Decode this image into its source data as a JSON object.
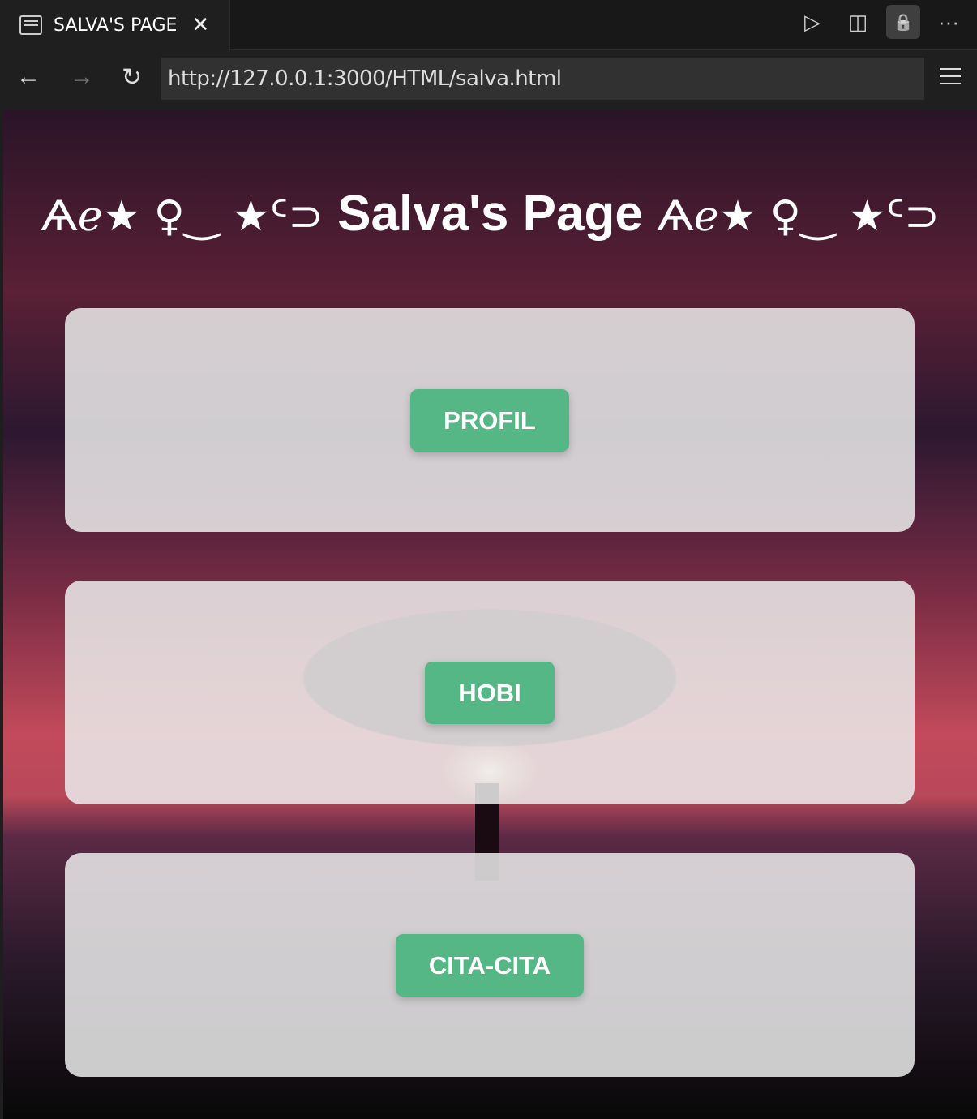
{
  "tab": {
    "title": "SALVA'S PAGE",
    "icon": "preview-icon",
    "close": "✕"
  },
  "toolbar": {
    "run": "▷",
    "split": "◫",
    "lock": "🔒",
    "more": "···"
  },
  "nav": {
    "back": "←",
    "forward": "→",
    "reload": "↻",
    "url": "http://127.0.0.1:3000/HTML/salva.html"
  },
  "page": {
    "title": "Salva's Page",
    "deco_left": "Ѧℯ★ ♀‿ ★ᑦ⊃",
    "deco_right": "Ѧℯ★ ♀‿ ★ᑦ⊃",
    "buttons": [
      "PROFIL",
      "HOBI",
      "CITA-CITA"
    ],
    "accent": "#55b785"
  }
}
